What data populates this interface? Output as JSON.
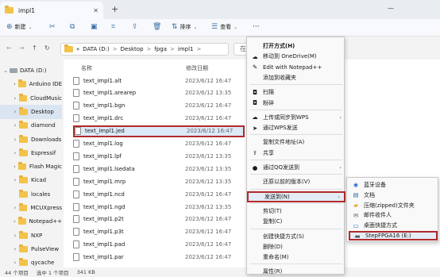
{
  "tab": {
    "title": "impl1",
    "close": "✕",
    "new": "+"
  },
  "window": {
    "minimize": "—"
  },
  "toolbar": {
    "new_label": "新建",
    "sort_label": "排序",
    "view_label": "查看",
    "more": "···"
  },
  "address": {
    "prefix": "«",
    "path": [
      "DATA (D:)",
      "Desktop",
      "fpga",
      "impl1"
    ],
    "sep": ">",
    "search_placeholder": "在"
  },
  "sidebar": {
    "items": [
      {
        "label": "DATA (D:)",
        "chev": "⌄",
        "type": "drive"
      },
      {
        "label": "Arduino IDE",
        "chev": "›",
        "type": "folder"
      },
      {
        "label": "CloudMusic",
        "chev": "›",
        "type": "folder"
      },
      {
        "label": "Desktop",
        "chev": "›",
        "type": "folder"
      },
      {
        "label": "diamond",
        "chev": "›",
        "type": "folder"
      },
      {
        "label": "Downloads",
        "chev": "›",
        "type": "folder"
      },
      {
        "label": "Espressif",
        "chev": "›",
        "type": "folder"
      },
      {
        "label": "Flash Magic",
        "chev": "›",
        "type": "folder"
      },
      {
        "label": "Kicad",
        "chev": "›",
        "type": "folder"
      },
      {
        "label": "locales",
        "chev": "",
        "type": "folder"
      },
      {
        "label": "MCUXpress",
        "chev": "›",
        "type": "folder"
      },
      {
        "label": "Notepad++",
        "chev": "›",
        "type": "folder"
      },
      {
        "label": "NXP",
        "chev": "›",
        "type": "folder"
      },
      {
        "label": "PulseView",
        "chev": "›",
        "type": "folder"
      },
      {
        "label": "qycache",
        "chev": "›",
        "type": "folder"
      }
    ]
  },
  "filelist": {
    "headers": {
      "name": "名称",
      "date": "修改日期"
    },
    "files": [
      {
        "name": "text_impl1.alt",
        "date": "2023/6/12 16:47"
      },
      {
        "name": "text_impl1.arearep",
        "date": "2023/6/12 13:35"
      },
      {
        "name": "text_impl1.bgn",
        "date": "2023/6/12 16:47"
      },
      {
        "name": "text_impl1.drc",
        "date": "2023/6/12 16:47"
      },
      {
        "name": "text_impl1.jed",
        "date": "2023/6/12 16:47"
      },
      {
        "name": "text_impl1.log",
        "date": "2023/6/12 16:47"
      },
      {
        "name": "text_impl1.lpf",
        "date": "2023/6/12 13:35"
      },
      {
        "name": "text_impl1.lsedata",
        "date": "2023/6/12 13:35"
      },
      {
        "name": "text_impl1.mrp",
        "date": "2023/6/12 13:35"
      },
      {
        "name": "text_impl1.ncd",
        "date": "2023/6/12 16:47"
      },
      {
        "name": "text_impl1.ngd",
        "date": "2023/6/12 13:35"
      },
      {
        "name": "text_impl1.p2t",
        "date": "2023/6/12 16:47"
      },
      {
        "name": "text_impl1.p3t",
        "date": "2023/6/12 16:47"
      },
      {
        "name": "text_impl1.pad",
        "date": "2023/6/12 16:47"
      },
      {
        "name": "text_impl1.par",
        "date": "2023/6/12 16:47"
      }
    ]
  },
  "status": {
    "count": "44 个项目",
    "selected": "选中 1 个项目",
    "size": "341 KB"
  },
  "context_menu": {
    "items": [
      {
        "label": "打开方式(H)",
        "icon": "",
        "bold": true,
        "arrow": ""
      },
      {
        "label": "移动到 OneDrive(M)",
        "icon": "☁",
        "arrow": ""
      },
      {
        "label": "Edit with Notepad++",
        "icon": "✎",
        "arrow": ""
      },
      {
        "label": "添加到收藏夹",
        "icon": "",
        "arrow": ""
      },
      {
        "sep": true
      },
      {
        "label": "扫描",
        "icon": "◘",
        "arrow": ""
      },
      {
        "label": "粉碎",
        "icon": "◘",
        "arrow": ""
      },
      {
        "sep": true
      },
      {
        "label": "上传或同步到WPS",
        "icon": "☁",
        "arrow": "›"
      },
      {
        "label": "通过WPS发送",
        "icon": "➤",
        "arrow": ""
      },
      {
        "sep": true
      },
      {
        "label": "复制文件地址(A)",
        "icon": "",
        "arrow": ""
      },
      {
        "label": "共享",
        "icon": "⇪",
        "arrow": ""
      },
      {
        "sep": true
      },
      {
        "label": "通过QQ发送到",
        "icon": "●",
        "arrow": "›"
      },
      {
        "sep": true
      },
      {
        "label": "还原以前的版本(V)",
        "icon": "",
        "arrow": ""
      },
      {
        "sep": true
      },
      {
        "label": "发送到(N)",
        "icon": "",
        "arrow": "›",
        "sendto": true
      },
      {
        "sep": true
      },
      {
        "label": "剪切(T)",
        "icon": "",
        "arrow": ""
      },
      {
        "label": "复制(C)",
        "icon": "",
        "arrow": ""
      },
      {
        "sep": true
      },
      {
        "label": "创建快捷方式(S)",
        "icon": "",
        "arrow": ""
      },
      {
        "label": "删除(D)",
        "icon": "",
        "arrow": ""
      },
      {
        "label": "重命名(M)",
        "icon": "",
        "arrow": ""
      },
      {
        "sep": true
      },
      {
        "label": "属性(R)",
        "icon": "",
        "arrow": ""
      }
    ]
  },
  "submenu": {
    "items": [
      {
        "label": "蓝牙设备",
        "icon": "✱",
        "color": "#2a6fd6"
      },
      {
        "label": "文档",
        "icon": "▤",
        "color": "#3a6ea5"
      },
      {
        "label": "压缩(zipped)文件夹",
        "icon": "▰",
        "color": "#e0a62c"
      },
      {
        "label": "邮件收件人",
        "icon": "✉",
        "color": "#555555"
      },
      {
        "label": "桌面快捷方式",
        "icon": "▭",
        "color": "#2a6fd6"
      },
      {
        "label": "StepFPGA16 (E:)",
        "icon": "▬",
        "color": "#555555",
        "target": true
      }
    ]
  },
  "colors": {
    "highlight_border": "#b22a2a",
    "accent": "#2a6fd6"
  }
}
